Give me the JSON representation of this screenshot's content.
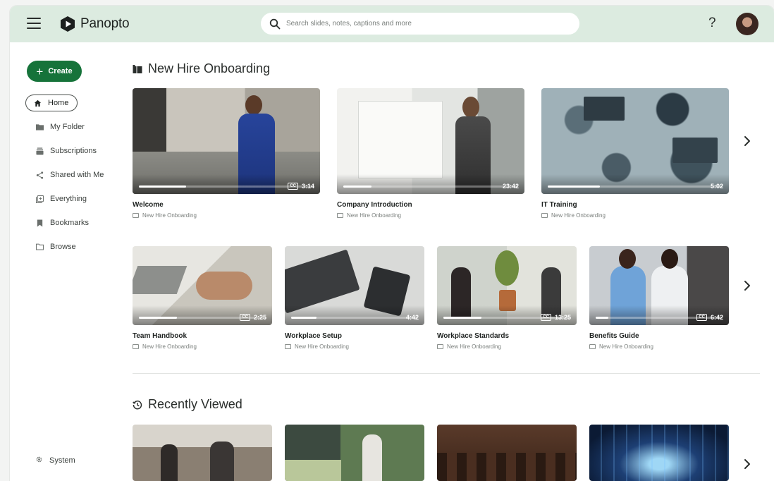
{
  "app": {
    "name": "Panopto"
  },
  "search": {
    "placeholder": "Search slides, notes, captions and more"
  },
  "header": {
    "help_label": "?"
  },
  "sidebar": {
    "create_label": "Create",
    "items": [
      {
        "label": "Home",
        "icon": "home-icon"
      },
      {
        "label": "My Folder",
        "icon": "folder-filled-icon"
      },
      {
        "label": "Subscriptions",
        "icon": "subscriptions-icon"
      },
      {
        "label": "Shared with Me",
        "icon": "share-icon"
      },
      {
        "label": "Everything",
        "icon": "stack-icon"
      },
      {
        "label": "Bookmarks",
        "icon": "bookmark-icon"
      },
      {
        "label": "Browse",
        "icon": "folder-outline-icon"
      }
    ],
    "system_label": "System"
  },
  "sections": {
    "onboarding": {
      "title": "New Hire Onboarding",
      "row1": [
        {
          "title": "Welcome",
          "folder": "New Hire Onboarding",
          "duration": "3:14",
          "cc": "CC",
          "progress": 0.27
        },
        {
          "title": "Company Introduction",
          "folder": "New Hire Onboarding",
          "duration": "23:42",
          "cc": "",
          "progress": 0.16
        },
        {
          "title": "IT Training",
          "folder": "New Hire Onboarding",
          "duration": "5:02",
          "cc": "",
          "progress": 0.3
        }
      ],
      "row2": [
        {
          "title": "Team Handbook",
          "folder": "New Hire Onboarding",
          "duration": "2:25",
          "cc": "CC",
          "progress": 0.3
        },
        {
          "title": "Workplace Setup",
          "folder": "New Hire Onboarding",
          "duration": "4:42",
          "cc": "",
          "progress": 0.2
        },
        {
          "title": "Workplace Standards",
          "folder": "New Hire Onboarding",
          "duration": "13:25",
          "cc": "CC",
          "progress": 0.3
        },
        {
          "title": "Benefits Guide",
          "folder": "New Hire Onboarding",
          "duration": "6:42",
          "cc": "CC",
          "progress": 0.1
        }
      ]
    },
    "recent": {
      "title": "Recently Viewed"
    }
  },
  "colors": {
    "accent": "#16733a",
    "topbar": "#dcebe0"
  }
}
